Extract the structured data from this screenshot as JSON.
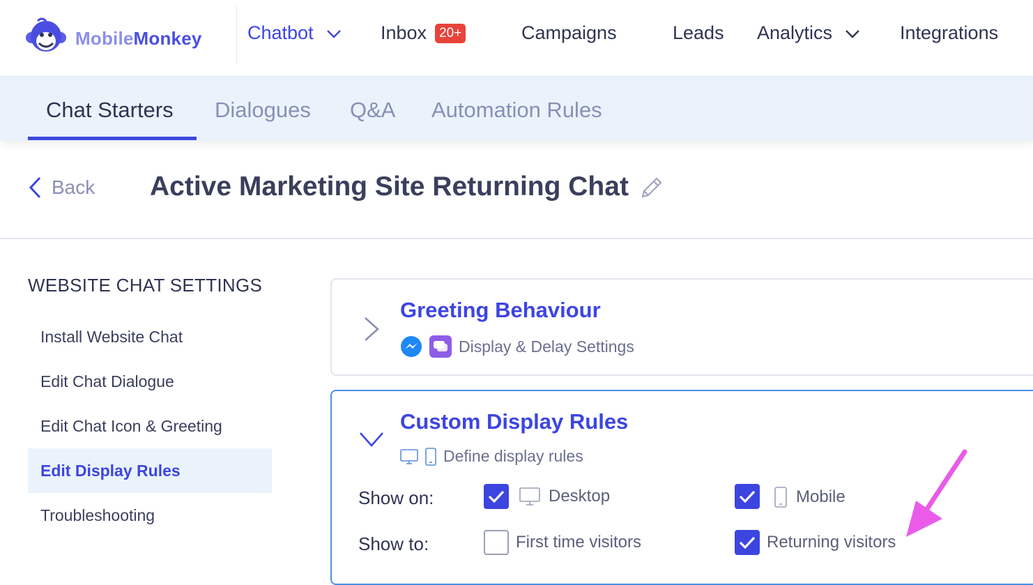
{
  "brand": {
    "name_part1": "Mobile",
    "name_part2": "Monkey"
  },
  "nav": {
    "items": [
      {
        "label": "Chatbot",
        "active": true,
        "has_dropdown": true
      },
      {
        "label": "Inbox",
        "badge": "20+"
      },
      {
        "label": "Campaigns"
      },
      {
        "label": "Leads"
      },
      {
        "label": "Analytics",
        "has_dropdown": true
      },
      {
        "label": "Integrations"
      }
    ]
  },
  "subtabs": [
    {
      "label": "Chat Starters",
      "active": true
    },
    {
      "label": "Dialogues"
    },
    {
      "label": "Q&A"
    },
    {
      "label": "Automation Rules"
    }
  ],
  "header": {
    "back_label": "Back",
    "title": "Active Marketing Site Returning Chat"
  },
  "sidebar": {
    "title": "WEBSITE CHAT SETTINGS",
    "items": [
      {
        "label": "Install Website Chat"
      },
      {
        "label": "Edit Chat Dialogue"
      },
      {
        "label": "Edit Chat Icon & Greeting"
      },
      {
        "label": "Edit Display Rules",
        "active": true
      },
      {
        "label": "Troubleshooting"
      }
    ]
  },
  "greeting_card": {
    "title": "Greeting Behaviour",
    "subtitle": "Display & Delay Settings",
    "expanded": false
  },
  "display_rules_card": {
    "title": "Custom Display Rules",
    "subtitle": "Define display rules",
    "expanded": true,
    "show_on_label": "Show on:",
    "show_to_label": "Show to:",
    "show_on": [
      {
        "label": "Desktop",
        "checked": true,
        "icon": "desktop-icon"
      },
      {
        "label": "Mobile",
        "checked": true,
        "icon": "mobile-icon"
      }
    ],
    "show_to": [
      {
        "label": "First time visitors",
        "checked": false
      },
      {
        "label": "Returning visitors",
        "checked": true
      }
    ]
  },
  "colors": {
    "accent": "#3d45e0",
    "badge": "#e8433a",
    "subtab_bg": "#eaf3fc",
    "arrow": "#e95be8"
  }
}
